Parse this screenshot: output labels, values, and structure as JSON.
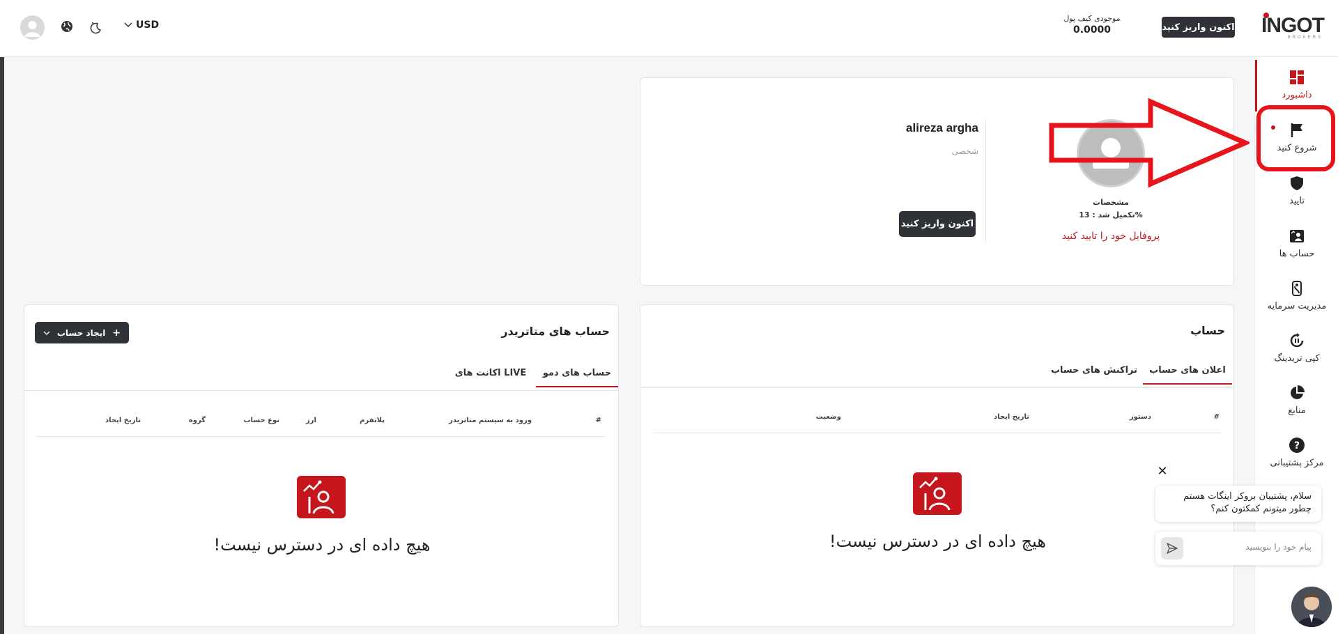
{
  "header": {
    "logo_text": "INGOT",
    "logo_sub": "BROKERS",
    "deposit_label": "اکنون واریز کنید",
    "wallet_label": "موجودی کیف پول",
    "wallet_value": "0.0000",
    "currency": "USD"
  },
  "sidebar": {
    "items": [
      {
        "label": "داشبورد",
        "icon": "dashboard-icon"
      },
      {
        "label": "شروع کنید",
        "icon": "flag-icon"
      },
      {
        "label": "تایید",
        "icon": "shield-icon"
      },
      {
        "label": "حساب ها",
        "icon": "accounts-icon"
      },
      {
        "label": "مدیریت سرمایه",
        "icon": "fund-management-icon"
      },
      {
        "label": "کپی تریدینگ",
        "icon": "copy-trading-icon"
      },
      {
        "label": "منابع",
        "icon": "resources-icon"
      },
      {
        "label": "مرکز پشتیبانی",
        "icon": "help-icon"
      }
    ]
  },
  "profile": {
    "name": "alireza argha",
    "type": "شخصی",
    "spec_label": "مشخصات",
    "completion": "تکمیل شد : 13%",
    "verify_link": "پروفایل خود را تایید کنید",
    "deposit_label": "اکنون واریز کنید"
  },
  "account": {
    "title": "حساب",
    "tabs": [
      "اعلان های حساب",
      "تراکنش های حساب"
    ],
    "columns": [
      "#",
      "دستور",
      "تاریخ ایجاد",
      "وضعیت"
    ],
    "empty_text": "!هیچ داده ای در دسترس نیست"
  },
  "metatrader": {
    "title": "حساب های متاتریدر",
    "create_label": "ایجاد حساب",
    "tabs": [
      "حساب های دمو",
      "اکانت های LIVE"
    ],
    "columns": [
      "#",
      "ورود به سیستم متاتریدر",
      "پلاتفرم",
      "ارز",
      "نوع حساب",
      "گروه",
      "تاریخ ایجاد"
    ],
    "empty_text": "!هیچ داده ای در دسترس نیست"
  },
  "chat": {
    "message": "سلام، پشتیبان بروکر اینگات هستم چطور میتونم کمکتون کنم؟",
    "placeholder": "پیام خود را بنویسید"
  },
  "colors": {
    "accent": "#c5161d",
    "dark_button": "#2f3236",
    "annotation": "#e8141b"
  }
}
